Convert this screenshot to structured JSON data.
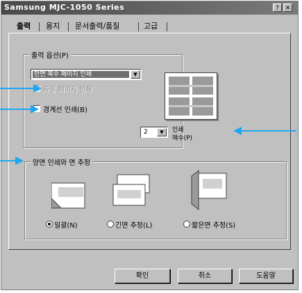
{
  "window": {
    "title": "Samsung  MJC-1050 Series"
  },
  "titlebar": {
    "help_glyph": "?",
    "close_glyph": "✕"
  },
  "tabs": [
    "출력",
    "용지",
    "문서출력/품질",
    "고급"
  ],
  "print_options": {
    "group_title": "출력 옵션(P)",
    "combo_value": "한면 복수 페이지 인쇄",
    "checkbox_page_order": "자동 페이지 인쇄",
    "checkbox_border": "경계선 인쇄(B)",
    "pages_value": "2",
    "pages_label_line1": "인쇄",
    "pages_label_line2": "매수(P)"
  },
  "duplex": {
    "group_title": "양면 인쇄와 면 추정",
    "radio_none": "일괄(N)",
    "radio_long": "긴면 추정(L)",
    "radio_short": "짧은면 추정(S)"
  },
  "buttons": {
    "ok": "확인",
    "cancel": "취소",
    "help": "도움말"
  },
  "colors": {
    "callout_arrow": "#1ea7f0",
    "titlebar": "#4a4a4a",
    "dialog_bg": "#c0c0c0"
  }
}
